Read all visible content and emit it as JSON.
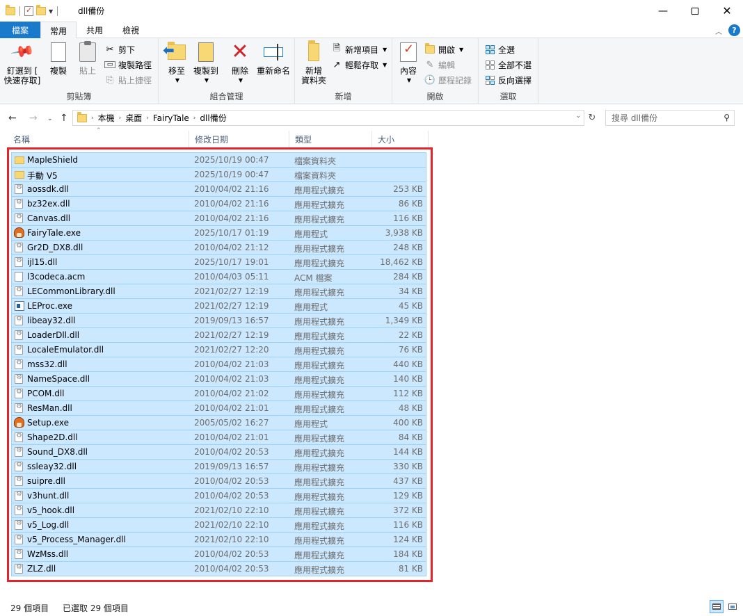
{
  "window": {
    "title": "dll備份",
    "minimize_glyph": "—",
    "close_glyph": "✕"
  },
  "ribbon": {
    "tabs": [
      {
        "label": "檔案"
      },
      {
        "label": "常用"
      },
      {
        "label": "共用"
      },
      {
        "label": "檢視"
      }
    ],
    "clipboard": {
      "label": "剪貼簿",
      "pin": "釘選到 [\n快速存取]",
      "copy": "複製",
      "paste": "貼上",
      "cut": "剪下",
      "copy_path": "複製路徑",
      "paste_shortcut": "貼上捷徑"
    },
    "organize": {
      "label": "組合管理",
      "move_to": "移至",
      "copy_to": "複製到",
      "delete": "刪除",
      "rename": "重新命名"
    },
    "new": {
      "label": "新增",
      "new_folder": "新增\n資料夾",
      "new_item": "新增項目",
      "easy_access": "輕鬆存取"
    },
    "open": {
      "label": "開啟",
      "properties": "內容",
      "open": "開啟",
      "edit": "編輯",
      "history": "歷程記錄"
    },
    "select": {
      "label": "選取",
      "select_all": "全選",
      "select_none": "全部不選",
      "invert": "反向選擇"
    }
  },
  "address": {
    "crumbs": [
      "本機",
      "桌面",
      "FairyTale",
      "dll備份"
    ],
    "search_placeholder": "搜尋 dll備份"
  },
  "columns": {
    "name": "名稱",
    "date": "修改日期",
    "type": "類型",
    "size": "大小"
  },
  "files": [
    {
      "name": "MapleShield",
      "date": "2025/10/19 00:47",
      "type": "檔案資料夾",
      "size": "",
      "icon": "folder"
    },
    {
      "name": "手動 V5",
      "date": "2025/10/19 00:47",
      "type": "檔案資料夾",
      "size": "",
      "icon": "folder"
    },
    {
      "name": "aossdk.dll",
      "date": "2010/04/02 21:16",
      "type": "應用程式擴充",
      "size": "253 KB",
      "icon": "dll"
    },
    {
      "name": "bz32ex.dll",
      "date": "2010/04/02 21:16",
      "type": "應用程式擴充",
      "size": "86 KB",
      "icon": "dll"
    },
    {
      "name": "Canvas.dll",
      "date": "2010/04/02 21:16",
      "type": "應用程式擴充",
      "size": "116 KB",
      "icon": "dll"
    },
    {
      "name": "FairyTale.exe",
      "date": "2025/10/17 01:19",
      "type": "應用程式",
      "size": "3,938 KB",
      "icon": "mushroom"
    },
    {
      "name": "Gr2D_DX8.dll",
      "date": "2010/04/02 21:12",
      "type": "應用程式擴充",
      "size": "248 KB",
      "icon": "dll"
    },
    {
      "name": "ijl15.dll",
      "date": "2025/10/17 19:01",
      "type": "應用程式擴充",
      "size": "18,462 KB",
      "icon": "dll"
    },
    {
      "name": "l3codeca.acm",
      "date": "2010/04/03 05:11",
      "type": "ACM 檔案",
      "size": "284 KB",
      "icon": "acm"
    },
    {
      "name": "LECommonLibrary.dll",
      "date": "2021/02/27 12:19",
      "type": "應用程式擴充",
      "size": "34 KB",
      "icon": "dll"
    },
    {
      "name": "LEProc.exe",
      "date": "2021/02/27 12:19",
      "type": "應用程式",
      "size": "45 KB",
      "icon": "exe"
    },
    {
      "name": "libeay32.dll",
      "date": "2019/09/13 16:57",
      "type": "應用程式擴充",
      "size": "1,349 KB",
      "icon": "dll"
    },
    {
      "name": "LoaderDll.dll",
      "date": "2021/02/27 12:19",
      "type": "應用程式擴充",
      "size": "22 KB",
      "icon": "dll"
    },
    {
      "name": "LocaleEmulator.dll",
      "date": "2021/02/27 12:20",
      "type": "應用程式擴充",
      "size": "76 KB",
      "icon": "dll"
    },
    {
      "name": "mss32.dll",
      "date": "2010/04/02 21:03",
      "type": "應用程式擴充",
      "size": "440 KB",
      "icon": "dll"
    },
    {
      "name": "NameSpace.dll",
      "date": "2010/04/02 21:03",
      "type": "應用程式擴充",
      "size": "140 KB",
      "icon": "dll"
    },
    {
      "name": "PCOM.dll",
      "date": "2010/04/02 21:02",
      "type": "應用程式擴充",
      "size": "112 KB",
      "icon": "dll"
    },
    {
      "name": "ResMan.dll",
      "date": "2010/04/02 21:01",
      "type": "應用程式擴充",
      "size": "48 KB",
      "icon": "dll"
    },
    {
      "name": "Setup.exe",
      "date": "2005/05/02 16:27",
      "type": "應用程式",
      "size": "400 KB",
      "icon": "mushroom"
    },
    {
      "name": "Shape2D.dll",
      "date": "2010/04/02 21:01",
      "type": "應用程式擴充",
      "size": "84 KB",
      "icon": "dll"
    },
    {
      "name": "Sound_DX8.dll",
      "date": "2010/04/02 20:53",
      "type": "應用程式擴充",
      "size": "144 KB",
      "icon": "dll"
    },
    {
      "name": "ssleay32.dll",
      "date": "2019/09/13 16:57",
      "type": "應用程式擴充",
      "size": "330 KB",
      "icon": "dll"
    },
    {
      "name": "suipre.dll",
      "date": "2010/04/02 20:53",
      "type": "應用程式擴充",
      "size": "437 KB",
      "icon": "dll"
    },
    {
      "name": "v3hunt.dll",
      "date": "2010/04/02 20:53",
      "type": "應用程式擴充",
      "size": "129 KB",
      "icon": "dll"
    },
    {
      "name": "v5_hook.dll",
      "date": "2021/02/10 22:10",
      "type": "應用程式擴充",
      "size": "372 KB",
      "icon": "dll"
    },
    {
      "name": "v5_Log.dll",
      "date": "2021/02/10 22:10",
      "type": "應用程式擴充",
      "size": "116 KB",
      "icon": "dll"
    },
    {
      "name": "v5_Process_Manager.dll",
      "date": "2021/02/10 22:10",
      "type": "應用程式擴充",
      "size": "124 KB",
      "icon": "dll"
    },
    {
      "name": "WzMss.dll",
      "date": "2010/04/02 20:53",
      "type": "應用程式擴充",
      "size": "184 KB",
      "icon": "dll"
    },
    {
      "name": "ZLZ.dll",
      "date": "2010/04/02 20:53",
      "type": "應用程式擴充",
      "size": "81 KB",
      "icon": "dll"
    }
  ],
  "status": {
    "count": "29 個項目",
    "selected": "已選取 29 個項目"
  },
  "colors": {
    "accent": "#1979ca",
    "selection_bg": "#cce8ff",
    "selection_border": "#99d1ff",
    "highlight_frame": "#e3242b"
  }
}
